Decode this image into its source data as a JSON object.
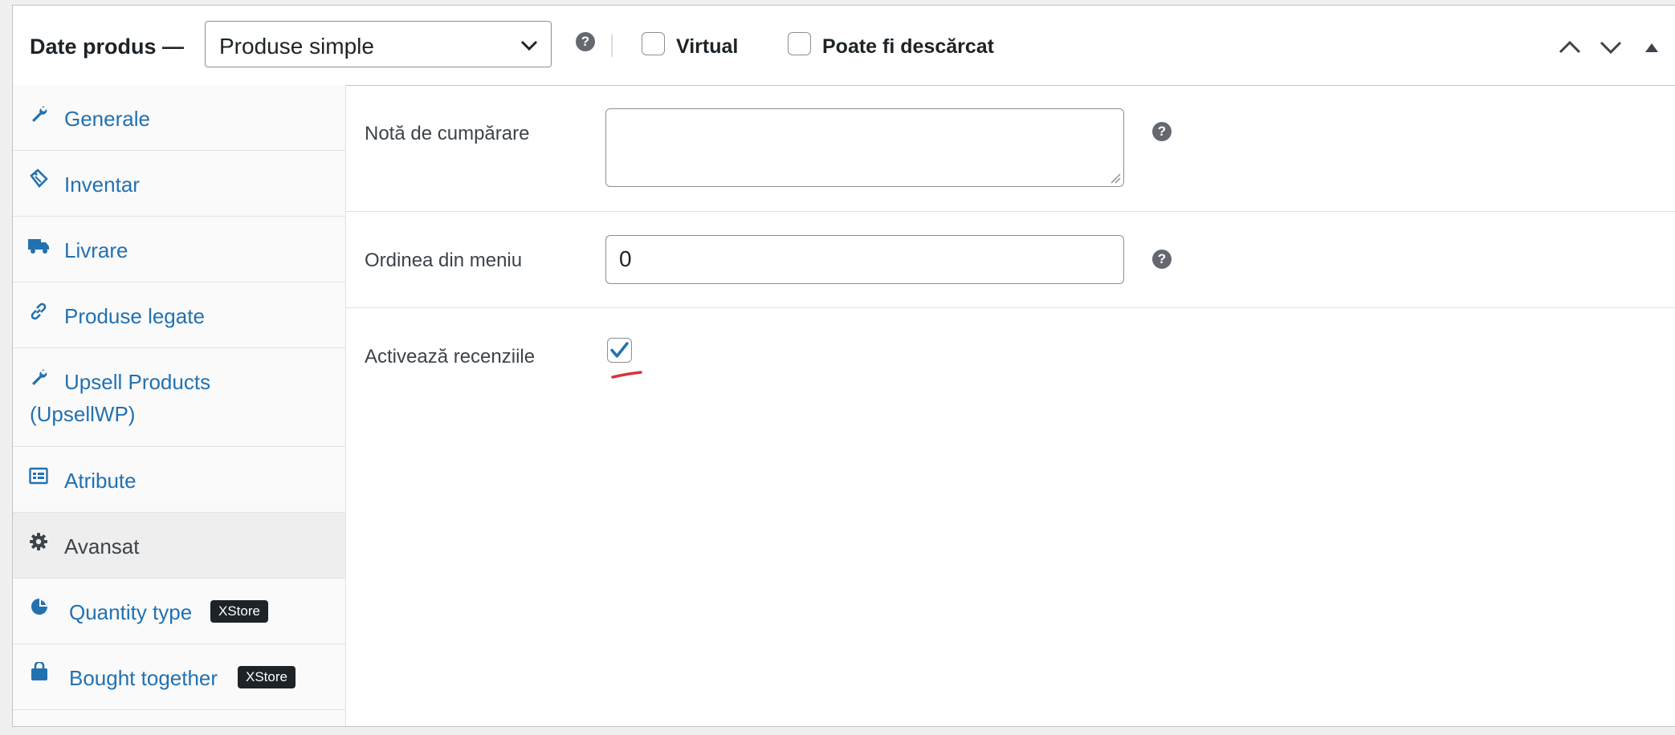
{
  "header": {
    "title": "Date produs —",
    "product_type": {
      "selected": "Produse simple"
    },
    "help_symbol": "?",
    "virtual": {
      "label": "Virtual",
      "checked": false
    },
    "downloadable": {
      "label": "Poate fi descărcat",
      "checked": false
    },
    "controls": [
      "move-up-icon",
      "move-down-icon",
      "toggle-panel-icon"
    ]
  },
  "sidebar": {
    "tabs": [
      {
        "label": "Generale",
        "icon": "wrench-icon",
        "active": false
      },
      {
        "label": "Inventar",
        "icon": "tag-icon",
        "active": false
      },
      {
        "label": "Livrare",
        "icon": "truck-icon",
        "active": false
      },
      {
        "label": "Produse legate",
        "icon": "link-icon",
        "active": false
      },
      {
        "label": "Upsell Products",
        "label_line2": "(UpsellWP)",
        "icon": "wrench-icon",
        "active": false
      },
      {
        "label": "Atribute",
        "icon": "list-table-icon",
        "active": false
      },
      {
        "label": "Avansat",
        "icon": "gear-icon",
        "active": true
      },
      {
        "label": "Quantity type",
        "icon": "pie-chart-icon",
        "badge": "XStore",
        "active": false
      },
      {
        "label": "Bought together",
        "icon": "shopping-bag-icon",
        "badge": "XStore",
        "active": false
      }
    ]
  },
  "advanced": {
    "purchase_note": {
      "label": "Notă de cumpărare",
      "value": ""
    },
    "menu_order": {
      "label": "Ordinea din meniu",
      "value": "0"
    },
    "enable_reviews": {
      "label": "Activează recenziile",
      "checked": true
    }
  },
  "colors": {
    "link": "#2271b1",
    "checkbox_check": "#2271b1",
    "annotation": "#d63638"
  }
}
